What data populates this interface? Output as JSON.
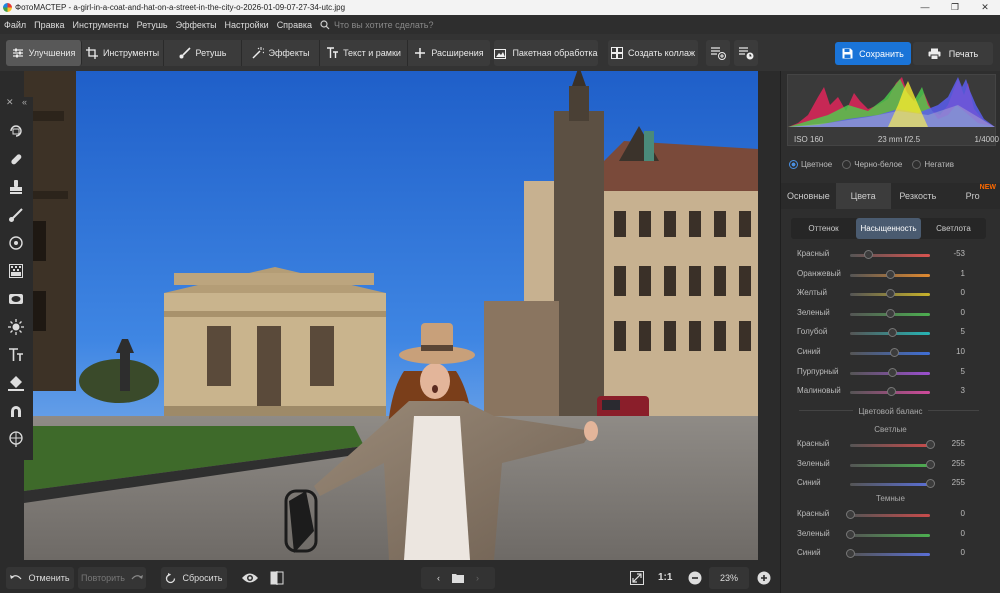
{
  "titlebar": {
    "title": "ФотоМАСТЕР - a-girl-in-a-coat-and-hat-on-a-street-in-the-city-o-2026-01-09-07-27-34-utc.jpg",
    "min": "—",
    "max": "❐",
    "close": "✕"
  },
  "menu": {
    "items": [
      "Файл",
      "Правка",
      "Инструменты",
      "Ретушь",
      "Эффекты",
      "Настройки",
      "Справка"
    ],
    "search_placeholder": "Что вы хотите сделать?"
  },
  "toolbar": {
    "tabs": [
      "Улучшения",
      "Инструменты",
      "Ретушь",
      "Эффекты",
      "Текст и рамки",
      "Расширения"
    ],
    "batch": "Пакетная обработка",
    "collage": "Создать коллаж",
    "save": "Сохранить",
    "print": "Печать"
  },
  "bottom": {
    "undo": "Отменить",
    "redo": "Повторить",
    "reset": "Сбросить",
    "ratio": "1:1",
    "zoom": "23%"
  },
  "histogram": {
    "iso": "ISO 160",
    "lens": "23 mm f/2.5",
    "shutter": "1/4000"
  },
  "mode": {
    "options": [
      "Цветное",
      "Черно-белое",
      "Негатив"
    ],
    "selected": "Цветное"
  },
  "panel_tabs": {
    "items": [
      "Основные",
      "Цвета",
      "Резкость",
      "Pro"
    ],
    "new_badge": "NEW",
    "active": "Цвета"
  },
  "sub_tabs": {
    "items": [
      "Оттенок",
      "Насыщенность",
      "Светлота"
    ],
    "active": "Насыщенность"
  },
  "saturation": [
    {
      "label": "Красный",
      "value": -53,
      "color": "#d9534f"
    },
    {
      "label": "Оранжевый",
      "value": 1,
      "color": "#e0892f"
    },
    {
      "label": "Желтый",
      "value": 0,
      "color": "#c8b22a"
    },
    {
      "label": "Зеленый",
      "value": 0,
      "color": "#4caf50"
    },
    {
      "label": "Голубой",
      "value": 5,
      "color": "#26b5b5"
    },
    {
      "label": "Синий",
      "value": 10,
      "color": "#3f6fd8"
    },
    {
      "label": "Пурпурный",
      "value": 5,
      "color": "#9c4fd0"
    },
    {
      "label": "Малиновый",
      "value": 3,
      "color": "#d04a9c"
    }
  ],
  "color_balance": {
    "title": "Цветовой баланс",
    "light_title": "Светлые",
    "dark_title": "Темные",
    "light": [
      {
        "label": "Красный",
        "value": 255,
        "color": "#c84b4b"
      },
      {
        "label": "Зеленый",
        "value": 255,
        "color": "#4caf50"
      },
      {
        "label": "Синий",
        "value": 255,
        "color": "#5a6fd6"
      }
    ],
    "dark": [
      {
        "label": "Красный",
        "value": 0,
        "color": "#c84b4b"
      },
      {
        "label": "Зеленый",
        "value": 0,
        "color": "#4caf50"
      },
      {
        "label": "Синий",
        "value": 0,
        "color": "#5a6fd6"
      }
    ]
  },
  "accent": "#1a74d8"
}
